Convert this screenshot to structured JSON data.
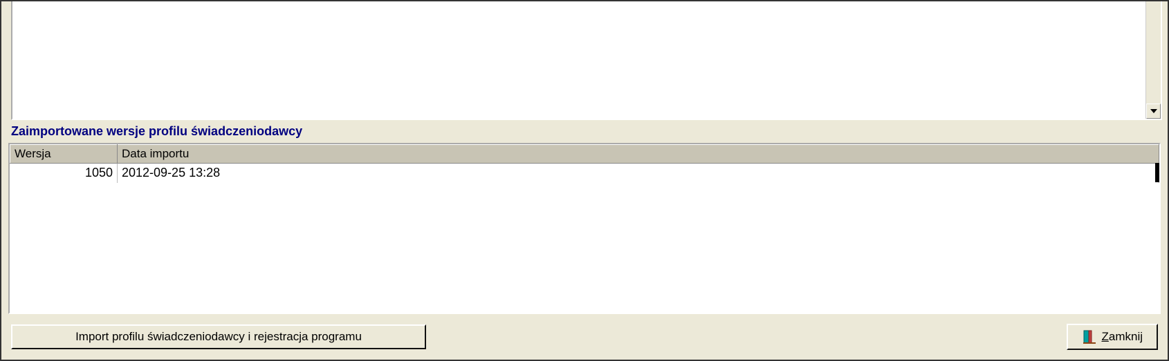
{
  "sectionTitle": "Zaimportowane wersje profilu świadczeniodawcy",
  "table": {
    "headers": {
      "version": "Wersja",
      "importDate": "Data importu"
    },
    "rows": [
      {
        "version": "1050",
        "importDate": "2012-09-25 13:28"
      }
    ]
  },
  "buttons": {
    "import": "Import profilu świadczeniodawcy i rejestracja programu",
    "close": "Zamknij"
  }
}
